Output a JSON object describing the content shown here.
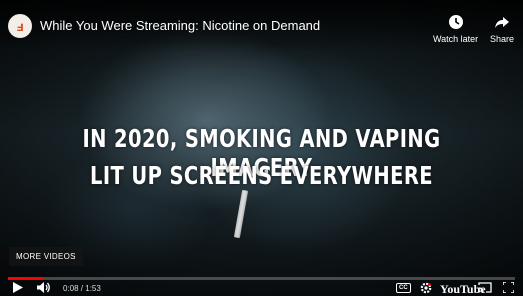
{
  "header": {
    "channel_logo_glyph": "ⅎ",
    "title": "While You Were Streaming: Nicotine on Demand",
    "watch_later_label": "Watch later",
    "share_label": "Share"
  },
  "overlay": {
    "line1": "IN 2020, SMOKING AND VAPING IMAGERY",
    "line2": "LIT UP SCREENS EVERYWHERE"
  },
  "more_videos_label": "MORE VIDEOS",
  "controls": {
    "time": "0:08 / 1:53",
    "progress_fraction": 0.07,
    "cc_label": "CC",
    "youtube_label": "YouTube"
  },
  "colors": {
    "progress": "#ff0000",
    "logo_accent": "#d9531e"
  },
  "icons": [
    "clock-icon",
    "share-arrow-icon",
    "play-icon",
    "volume-icon",
    "gear-icon",
    "cast-icon",
    "fullscreen-icon"
  ]
}
